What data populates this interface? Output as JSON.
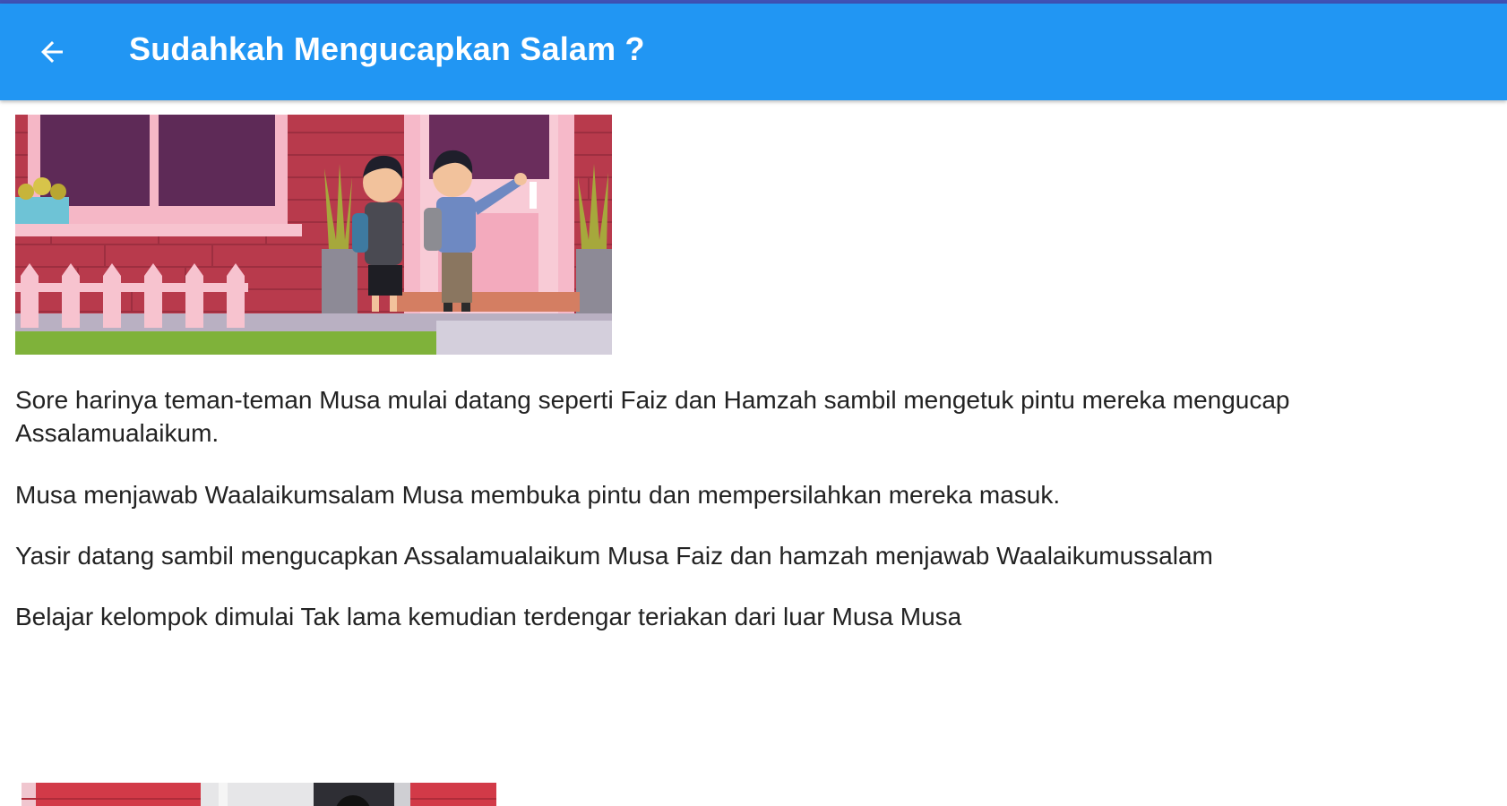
{
  "app_bar": {
    "title": "Sudahkah Mengucapkan Salam ?",
    "back_icon": "arrow-left-icon",
    "color": "#2196f3"
  },
  "status_strip_color": "#3f51b5",
  "content": {
    "images": [
      {
        "name": "scene-children-at-door"
      },
      {
        "name": "next-scene-partial"
      }
    ],
    "paragraphs": [
      "Sore harinya teman-teman Musa mulai datang seperti Faiz dan Hamzah sambil mengetuk pintu mereka mengucap Assalamualaikum.",
      "Musa menjawab Waalaikumsalam Musa membuka pintu dan mempersilahkan mereka masuk.",
      "Yasir datang sambil mengucapkan Assalamualaikum Musa Faiz dan hamzah menjawab Waalaikumussalam",
      "Belajar kelompok dimulai  Tak lama kemudian terdengar teriakan dari luar Musa Musa"
    ]
  }
}
